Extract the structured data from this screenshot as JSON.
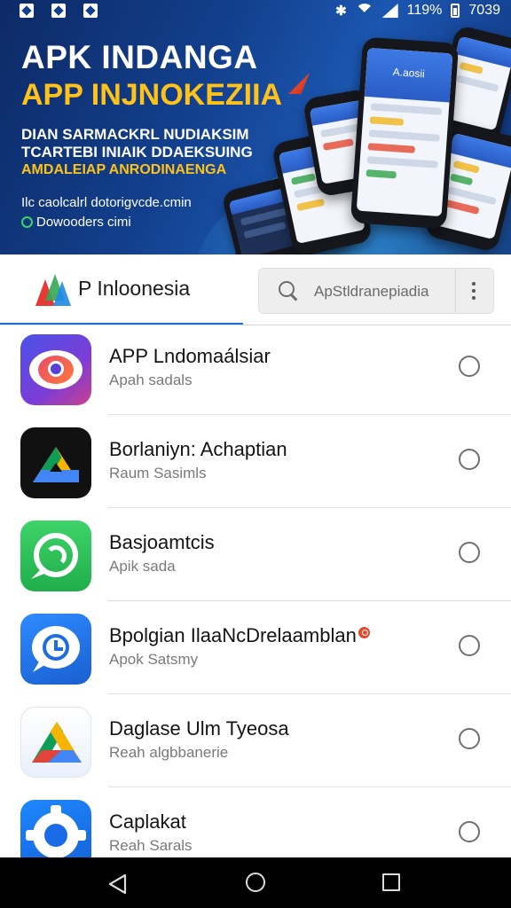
{
  "status_bar": {
    "bluetooth": "✱",
    "battery_percent": "119%",
    "time": "7039"
  },
  "banner": {
    "title_line1": "APK INDANGA",
    "title_line2": "APP INJNOKEZIIA",
    "subtitle_line1": "DIAN SARMACKRL NUDIAKSIM",
    "subtitle_line2": "TCARTEBI INIAIK DDAEKSUING",
    "subtitle_line3": "AMDALEIAP ANRODINAENGA",
    "url_line1": "Ilc caolcalrl dotorigvcde.cmin",
    "url_line2": "Dowooders cimi",
    "phone_badge": "A.aosii",
    "colors": {
      "accent": "#ffc21a",
      "primary": "#123f8c"
    }
  },
  "header": {
    "brand_name": "P Inloonesia",
    "search_placeholder": "ApStldranepiadia",
    "accent_color": "#1d6fd1"
  },
  "apps": [
    {
      "title": "APP Lndomaálsiar",
      "subtitle": "Apah sadals",
      "icon": "eye-icon",
      "selected": false
    },
    {
      "title": "Borlaniyn: Achaptian",
      "subtitle": "Raum Sasimls",
      "icon": "drive-dark-icon",
      "selected": false
    },
    {
      "title": "Basjoamtcis",
      "subtitle": "Apik sada",
      "icon": "chat-green-icon",
      "selected": false
    },
    {
      "title": "Bpolgian IlaaNcDrelaamblan",
      "subtitle": "Apok Satsmy",
      "icon": "chat-blue-icon",
      "selected": false,
      "notification": true
    },
    {
      "title": "Daglase Ulm Tyeosa",
      "subtitle": "Reah algbbanerie",
      "icon": "drive-light-icon",
      "selected": false
    },
    {
      "title": "Caplakat",
      "subtitle": "Reah Sarals",
      "icon": "gear-icon",
      "selected": false
    }
  ],
  "nav": {
    "back": "back-icon",
    "home": "home-icon",
    "recents": "recents-icon"
  }
}
